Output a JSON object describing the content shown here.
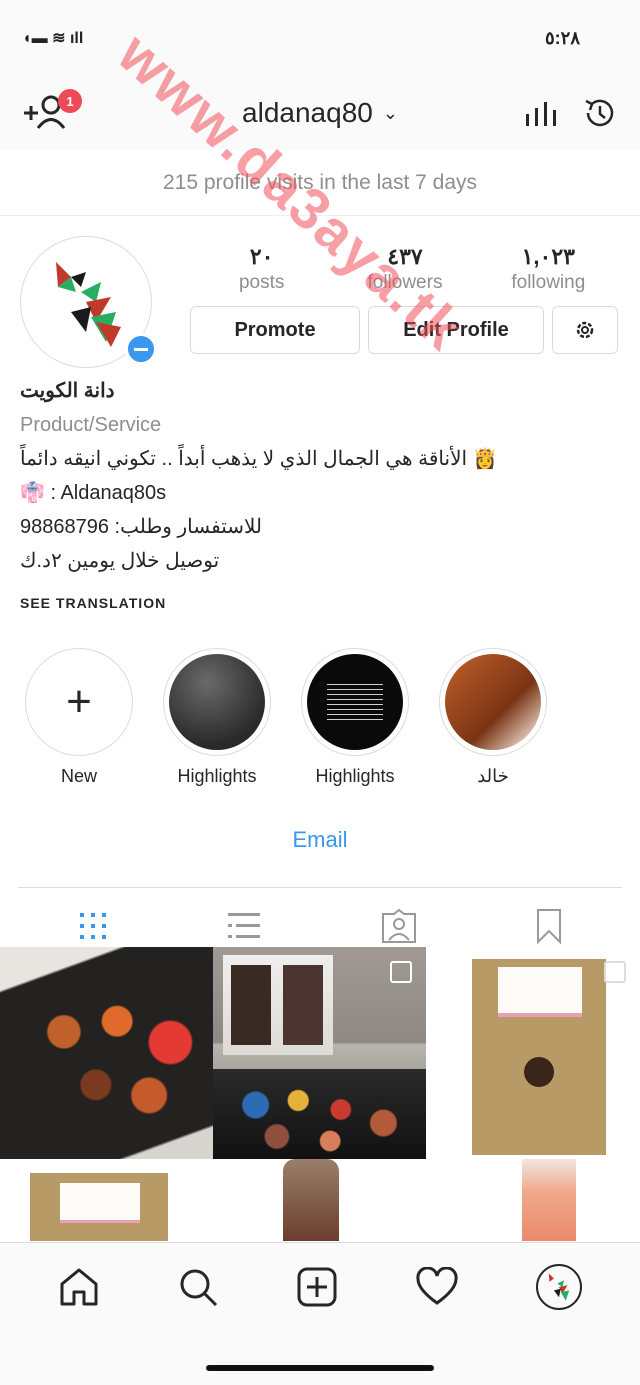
{
  "status": {
    "time": "٥:٢٨"
  },
  "watermark": "www.da3aya.tk",
  "nav": {
    "username": "aldanaq80",
    "notification_count": "1"
  },
  "visits": "215 profile visits in the last 7 days",
  "profile": {
    "stats": [
      {
        "num": "٢٠",
        "label": "posts"
      },
      {
        "num": "٤٣٧",
        "label": "followers"
      },
      {
        "num": "١,٠٢٣",
        "label": "following"
      }
    ],
    "promote_label": "Promote",
    "edit_label": "Edit Profile"
  },
  "bio": {
    "name": "دانة الكويت",
    "category": "Product/Service",
    "line1": "الأناقة هي الجمال الذي لا يذهب أبداً .. تكوني انيقه دائماً 👸",
    "line2": "👘 : Aldanaq80s",
    "line3": "للاستفسار وطلب: 98868796",
    "line4": "توصيل خلال يومين ٢د.ك",
    "see_translation": "SEE TRANSLATION"
  },
  "highlights": [
    {
      "label": "New"
    },
    {
      "label": "Highlights"
    },
    {
      "label": "Highlights"
    },
    {
      "label": "خالد"
    }
  ],
  "email_label": "Email",
  "colors": {
    "accent": "#3897f0",
    "badge": "#ed4956"
  }
}
